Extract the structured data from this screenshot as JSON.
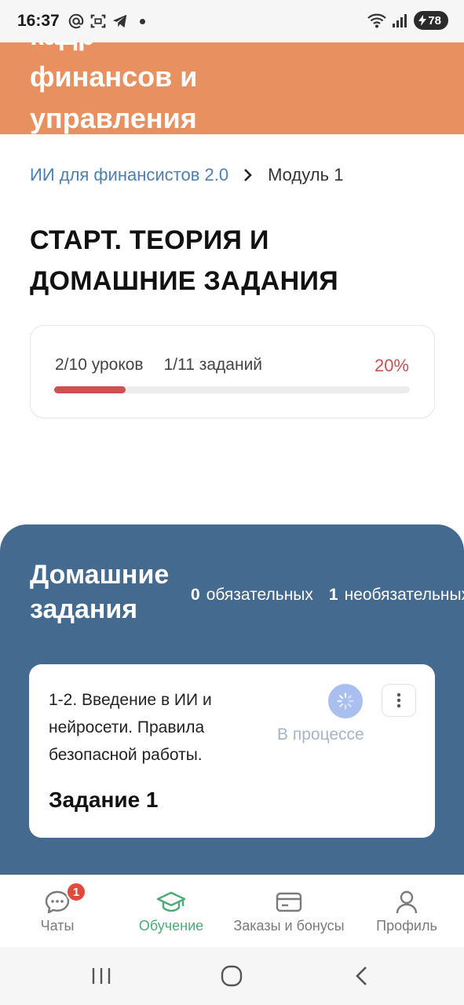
{
  "status_bar": {
    "time": "16:37",
    "battery": "78",
    "icons": [
      "at-icon",
      "scan-icon",
      "telegram-icon",
      "dot-icon",
      "wifi-icon",
      "signal-icon",
      "battery-charging-icon"
    ]
  },
  "banner": {
    "title": "кадр\nфинансов и\nуправления",
    "color": "#e8905f"
  },
  "breadcrumb": {
    "course": "ИИ для финансистов 2.0",
    "module": "Модуль 1"
  },
  "page_title": "СТАРТ. ТЕОРИЯ И ДОМАШНИЕ ЗАДАНИЯ",
  "progress": {
    "lessons": "2/10 уроков",
    "tasks": "1/11 заданий",
    "percent_label": "20%",
    "fraction": 0.2
  },
  "homework": {
    "title": "Домашние задания",
    "required_count": "0",
    "required_label": "обязательных",
    "optional_count": "1",
    "optional_label": "необязательных",
    "card": {
      "name": "1-2. Введение в ИИ и нейросети. Правила безопасной работы.",
      "status": "В процессе",
      "label": "Задание 1"
    }
  },
  "bottom_nav": {
    "items": [
      {
        "label": "Чаты",
        "icon": "chat-icon",
        "badge": "1"
      },
      {
        "label": "Обучение",
        "icon": "graduation-cap-icon"
      },
      {
        "label": "Заказы и бонусы",
        "icon": "card-icon"
      },
      {
        "label": "Профиль",
        "icon": "profile-icon"
      }
    ],
    "active_color": "#4eaa77"
  },
  "system_nav": [
    "recent-apps-icon",
    "home-icon",
    "back-icon"
  ]
}
